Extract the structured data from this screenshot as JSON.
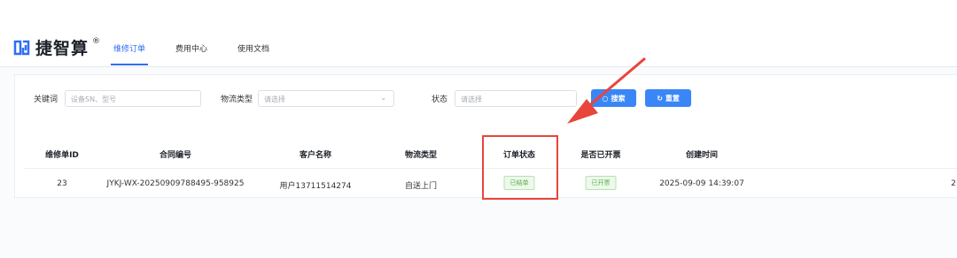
{
  "brand": {
    "name": "捷智算",
    "reg_mark": "®",
    "color": "#2f6df6"
  },
  "nav": {
    "tabs": [
      {
        "label": "维修订单",
        "active": true
      },
      {
        "label": "费用中心",
        "active": false
      },
      {
        "label": "使用文档",
        "active": false
      }
    ]
  },
  "filters": {
    "keyword_label": "关键词",
    "keyword_placeholder": "设备SN、型号",
    "logistics_label": "物流类型",
    "logistics_placeholder": "请选择",
    "status_label": "状态",
    "status_placeholder": "请选择",
    "search_label": "搜索",
    "reset_label": "重置"
  },
  "table": {
    "columns": [
      "维修单ID",
      "合同编号",
      "客户名称",
      "物流类型",
      "订单状态",
      "是否已开票",
      "创建时间"
    ],
    "rows": [
      {
        "id": "23",
        "contract": "JYKJ-WX-20250909788495-958925",
        "customer": "用户13711514274",
        "logistics": "自送上门",
        "order_status": "已结单",
        "invoiced": "已开票",
        "created": "2025-09-09 14:39:07",
        "overflow": "2"
      }
    ]
  },
  "colors": {
    "accent": "#3a86f7",
    "tag_green": "#52b040",
    "annotation_red": "#e8453c"
  }
}
